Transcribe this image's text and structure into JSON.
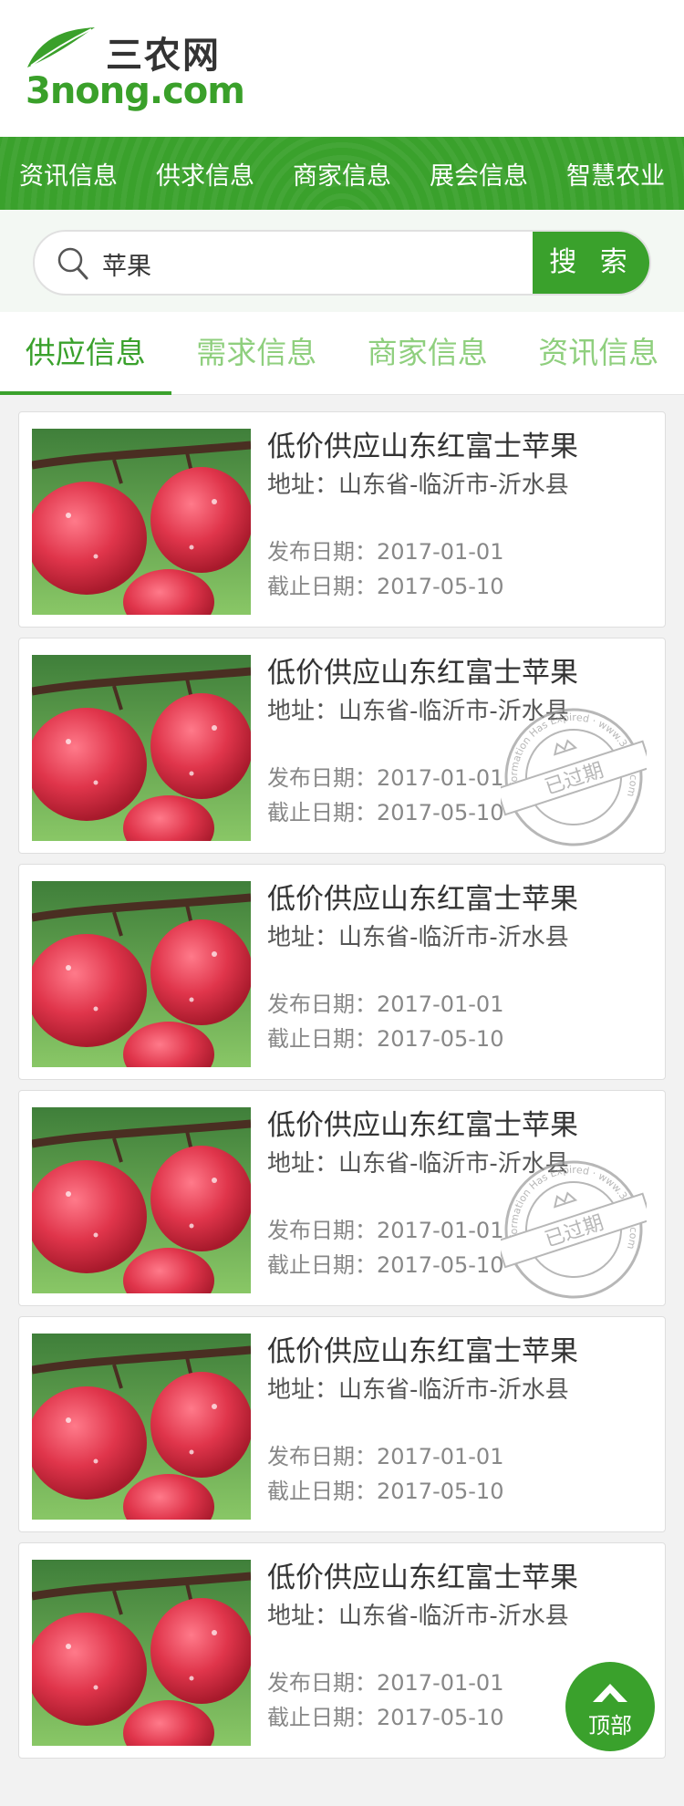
{
  "site": {
    "logo_cn": "三农网",
    "logo_en": "3nong.com"
  },
  "nav": [
    "资讯信息",
    "供求信息",
    "商家信息",
    "展会信息",
    "智慧农业"
  ],
  "search": {
    "value": "苹果",
    "button_label": "搜 索"
  },
  "tabs": [
    {
      "label": "供应信息",
      "active": true
    },
    {
      "label": "需求信息",
      "active": false
    },
    {
      "label": "商家信息",
      "active": false
    },
    {
      "label": "资讯信息",
      "active": false
    }
  ],
  "listings": [
    {
      "title": "低价供应山东红富士苹果",
      "address": "地址：山东省-临沂市-沂水县",
      "publish": "发布日期：2017-01-01",
      "deadline": "截止日期：2017-05-10",
      "expired": false
    },
    {
      "title": "低价供应山东红富士苹果",
      "address": "地址：山东省-临沂市-沂水县",
      "publish": "发布日期：2017-01-01",
      "deadline": "截止日期：2017-05-10",
      "expired": true
    },
    {
      "title": "低价供应山东红富士苹果",
      "address": "地址：山东省-临沂市-沂水县",
      "publish": "发布日期：2017-01-01",
      "deadline": "截止日期：2017-05-10",
      "expired": false
    },
    {
      "title": "低价供应山东红富士苹果",
      "address": "地址：山东省-临沂市-沂水县",
      "publish": "发布日期：2017-01-01",
      "deadline": "截止日期：2017-05-10",
      "expired": true
    },
    {
      "title": "低价供应山东红富士苹果",
      "address": "地址：山东省-临沂市-沂水县",
      "publish": "发布日期：2017-01-01",
      "deadline": "截止日期：2017-05-10",
      "expired": false
    },
    {
      "title": "低价供应山东红富士苹果",
      "address": "地址：山东省-临沂市-沂水县",
      "publish": "发布日期：2017-01-01",
      "deadline": "截止日期：2017-05-10",
      "expired": false
    }
  ],
  "stamp": {
    "text": "已过期",
    "ring_text": "Information Has Expired · www.3nong.com"
  },
  "back_to_top": "顶部",
  "colors": {
    "brand": "#3aa12c",
    "tab_inactive": "#8fcf7e"
  }
}
